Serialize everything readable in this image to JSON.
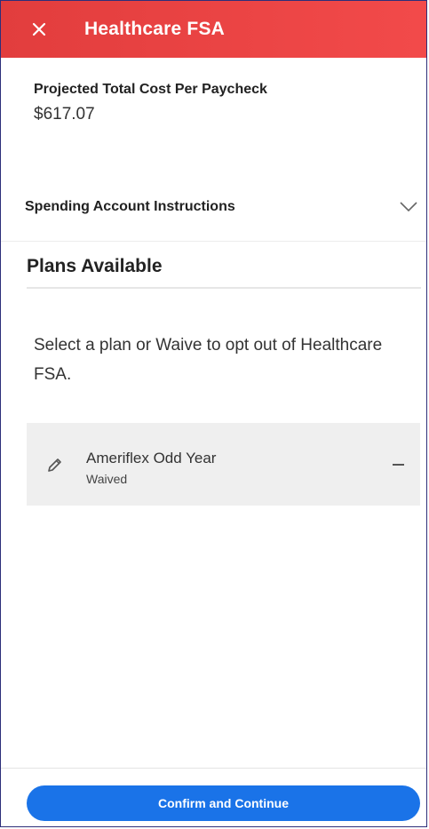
{
  "header": {
    "title": "Healthcare FSA",
    "close_icon": "close-icon"
  },
  "cost": {
    "label": "Projected Total Cost Per Paycheck",
    "value": "$617.07"
  },
  "instructions": {
    "label": "Spending Account Instructions",
    "icon": "chevron-down-icon"
  },
  "plans": {
    "title": "Plans Available",
    "instruction_text": "Select a plan or Waive to opt out of Healthcare FSA.",
    "items": [
      {
        "name": "Ameriflex Odd Year",
        "status": "Waived",
        "value": "–",
        "icon": "pencil-icon"
      }
    ]
  },
  "footer": {
    "confirm_label": "Confirm and Continue"
  },
  "colors": {
    "header": "#e83f3f",
    "primary": "#1a73e8",
    "card": "#efefef"
  }
}
